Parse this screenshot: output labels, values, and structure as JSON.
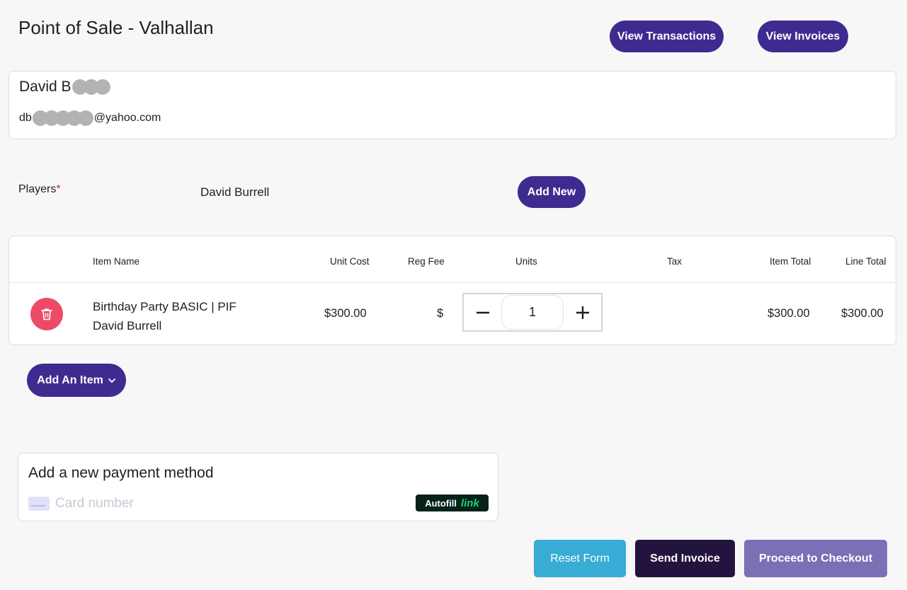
{
  "header": {
    "title": "Point of Sale - Valhallan",
    "view_transactions_label": "View Transactions",
    "view_invoices_label": "View Invoices"
  },
  "customer": {
    "name_visible": "David B",
    "email_prefix": "db",
    "email_suffix": "@yahoo.com"
  },
  "players": {
    "label": "Players",
    "required_mark": "*",
    "selected": "David Burrell",
    "add_new_label": "Add New"
  },
  "items_table": {
    "columns": [
      "Item Name",
      "Unit Cost",
      "Reg Fee",
      "Units",
      "Tax",
      "Item Total",
      "Line Total"
    ],
    "rows": [
      {
        "item_name": "Birthday Party BASIC | PIF",
        "player": "David Burrell",
        "unit_cost": "$300.00",
        "reg_fee": "$",
        "units": "1",
        "tax": "",
        "item_total": "$300.00",
        "line_total": "$300.00"
      }
    ]
  },
  "add_item": {
    "label": "Add An Item"
  },
  "payment": {
    "title": "Add a new payment method",
    "card_placeholder": "Card number",
    "autofill_label": "Autofill",
    "autofill_link": "link"
  },
  "actions": {
    "reset_label": "Reset Form",
    "send_invoice_label": "Send Invoice",
    "checkout_label": "Proceed to Checkout"
  },
  "colors": {
    "primary": "#3f2b8f",
    "delete": "#ec4a67",
    "reset": "#38acd4",
    "send_invoice": "#22143f",
    "checkout": "#7b70b6",
    "autofill_bg": "#04221a",
    "autofill_link": "#19d36b"
  },
  "icons": {
    "delete": "trash-icon",
    "minus": "minus-icon",
    "plus": "plus-icon",
    "dropdown": "chevron-down-icon",
    "card": "credit-card-icon"
  }
}
